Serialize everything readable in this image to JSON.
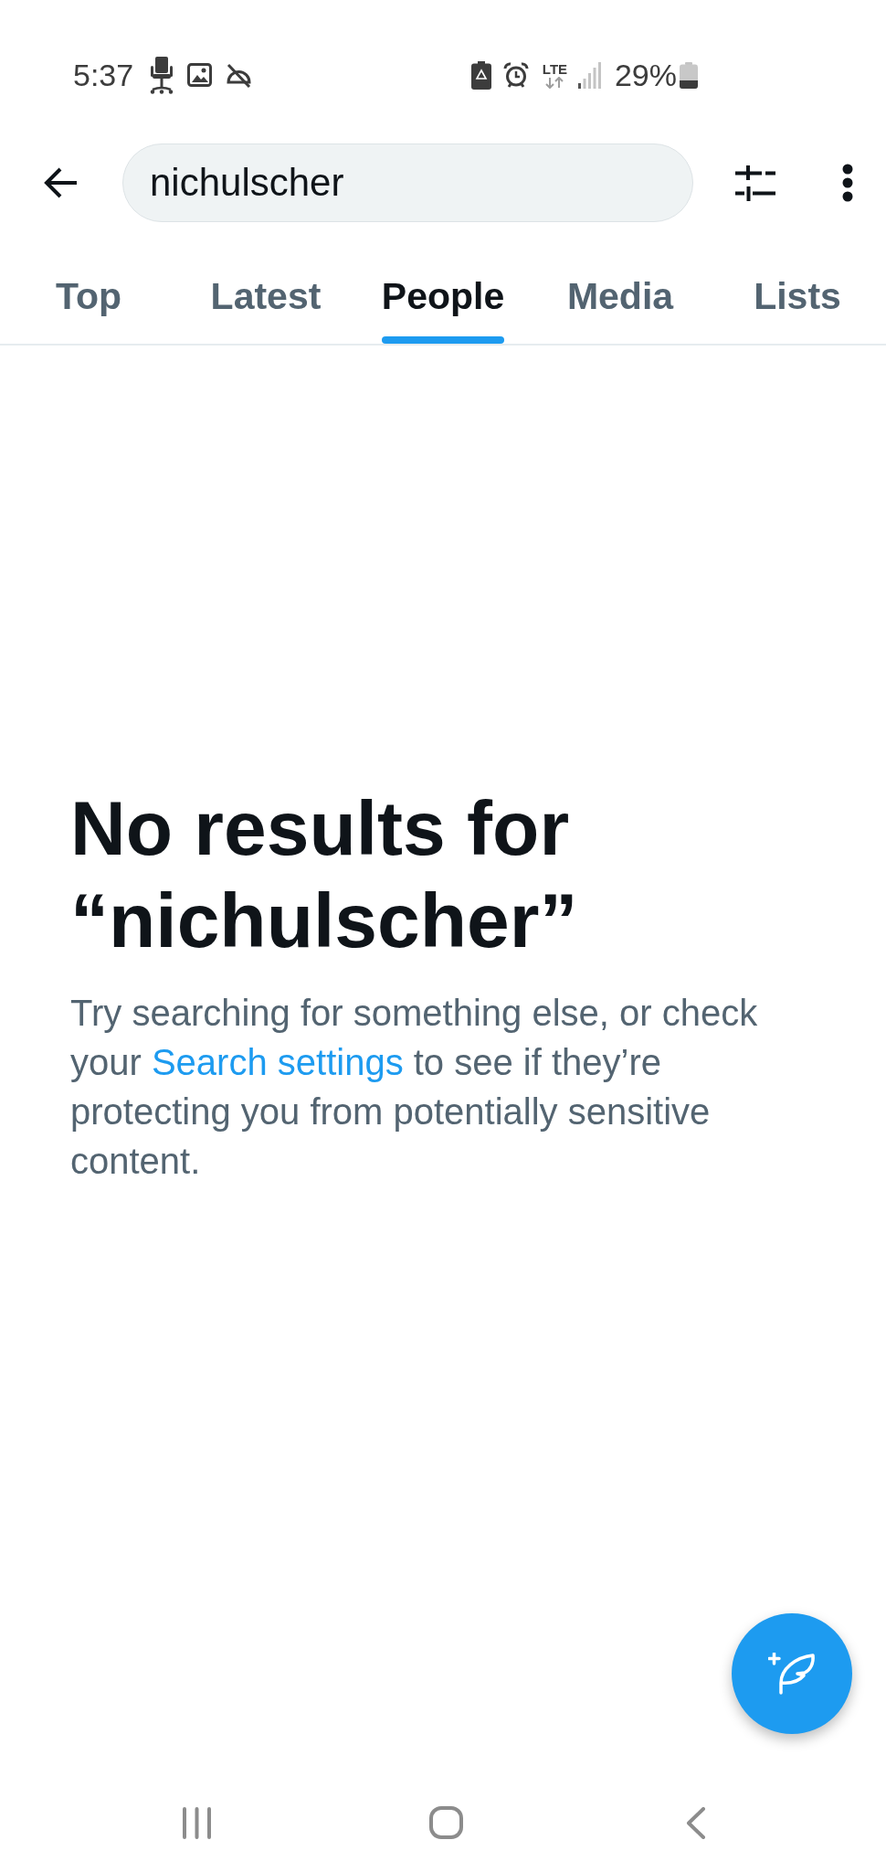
{
  "status_bar": {
    "time": "5:37",
    "network_type": "LTE",
    "battery_percent": "29%"
  },
  "search": {
    "value": "nichulscher"
  },
  "tabs": [
    {
      "label": "Top",
      "selected": false
    },
    {
      "label": "Latest",
      "selected": false
    },
    {
      "label": "People",
      "selected": true
    },
    {
      "label": "Media",
      "selected": false
    },
    {
      "label": "Lists",
      "selected": false
    }
  ],
  "empty_state": {
    "title": "No results for “nichulscher”",
    "message": {
      "before": "Try searching for something else, or check your",
      "link": "Search settings",
      "after": "to see if they’re protecting you from potentially sensitive content."
    }
  }
}
